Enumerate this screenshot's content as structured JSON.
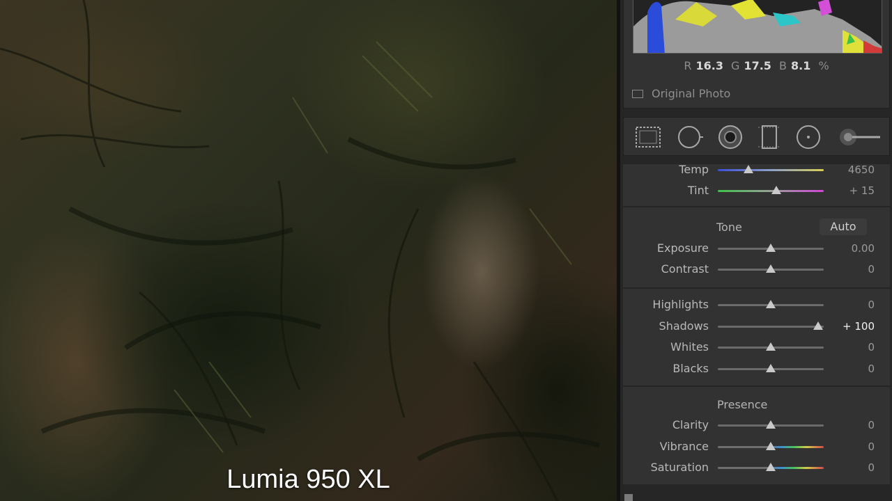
{
  "caption": "Lumia 950 XL",
  "histogram": {
    "r_label": "R",
    "r_value": "16.3",
    "g_label": "G",
    "g_value": "17.5",
    "b_label": "B",
    "b_value": "8.1",
    "unit": "%",
    "original_photo_label": "Original Photo"
  },
  "tools": [
    "crop-overlay-icon",
    "spot-removal-icon",
    "red-eye-icon",
    "graduated-filter-icon",
    "radial-filter-icon",
    "adjustment-brush-icon"
  ],
  "basic": {
    "white_balance": [
      {
        "name": "temp",
        "label": "Temp",
        "value": "4650",
        "fraction": 0.29,
        "track": "linear-gradient(90deg,#3a4fd8,#8ea0c8,#d8cf55)"
      },
      {
        "name": "tint",
        "label": "Tint",
        "value": "+ 15",
        "fraction": 0.55,
        "track": "linear-gradient(90deg,#3fc24a,#9aa09a,#d046d6)"
      }
    ],
    "tone_title": "Tone",
    "auto_label": "Auto",
    "tone": [
      {
        "name": "exposure",
        "label": "Exposure",
        "value": "0.00",
        "fraction": 0.5
      },
      {
        "name": "contrast",
        "label": "Contrast",
        "value": "0",
        "fraction": 0.5
      }
    ],
    "tone2": [
      {
        "name": "highlights",
        "label": "Highlights",
        "value": "0",
        "fraction": 0.5
      },
      {
        "name": "shadows",
        "label": "Shadows",
        "value": "+ 100",
        "fraction": 0.95,
        "hot": true
      },
      {
        "name": "whites",
        "label": "Whites",
        "value": "0",
        "fraction": 0.5
      },
      {
        "name": "blacks",
        "label": "Blacks",
        "value": "0",
        "fraction": 0.5
      }
    ],
    "presence_title": "Presence",
    "presence": [
      {
        "name": "clarity",
        "label": "Clarity",
        "value": "0",
        "fraction": 0.5
      },
      {
        "name": "vibrance",
        "label": "Vibrance",
        "value": "0",
        "fraction": 0.5,
        "track": "linear-gradient(90deg,#6e6e6e 0%,#6e6e6e 45%,#3f8fd2 60%,#49c25a 72%,#d7c94a 84%,#d04a4a 100%)"
      },
      {
        "name": "saturation",
        "label": "Saturation",
        "value": "0",
        "fraction": 0.5,
        "track": "linear-gradient(90deg,#6e6e6e 0%,#6e6e6e 45%,#3f8fd2 60%,#49c25a 72%,#d7c94a 84%,#d04a4a 100%)"
      }
    ]
  }
}
